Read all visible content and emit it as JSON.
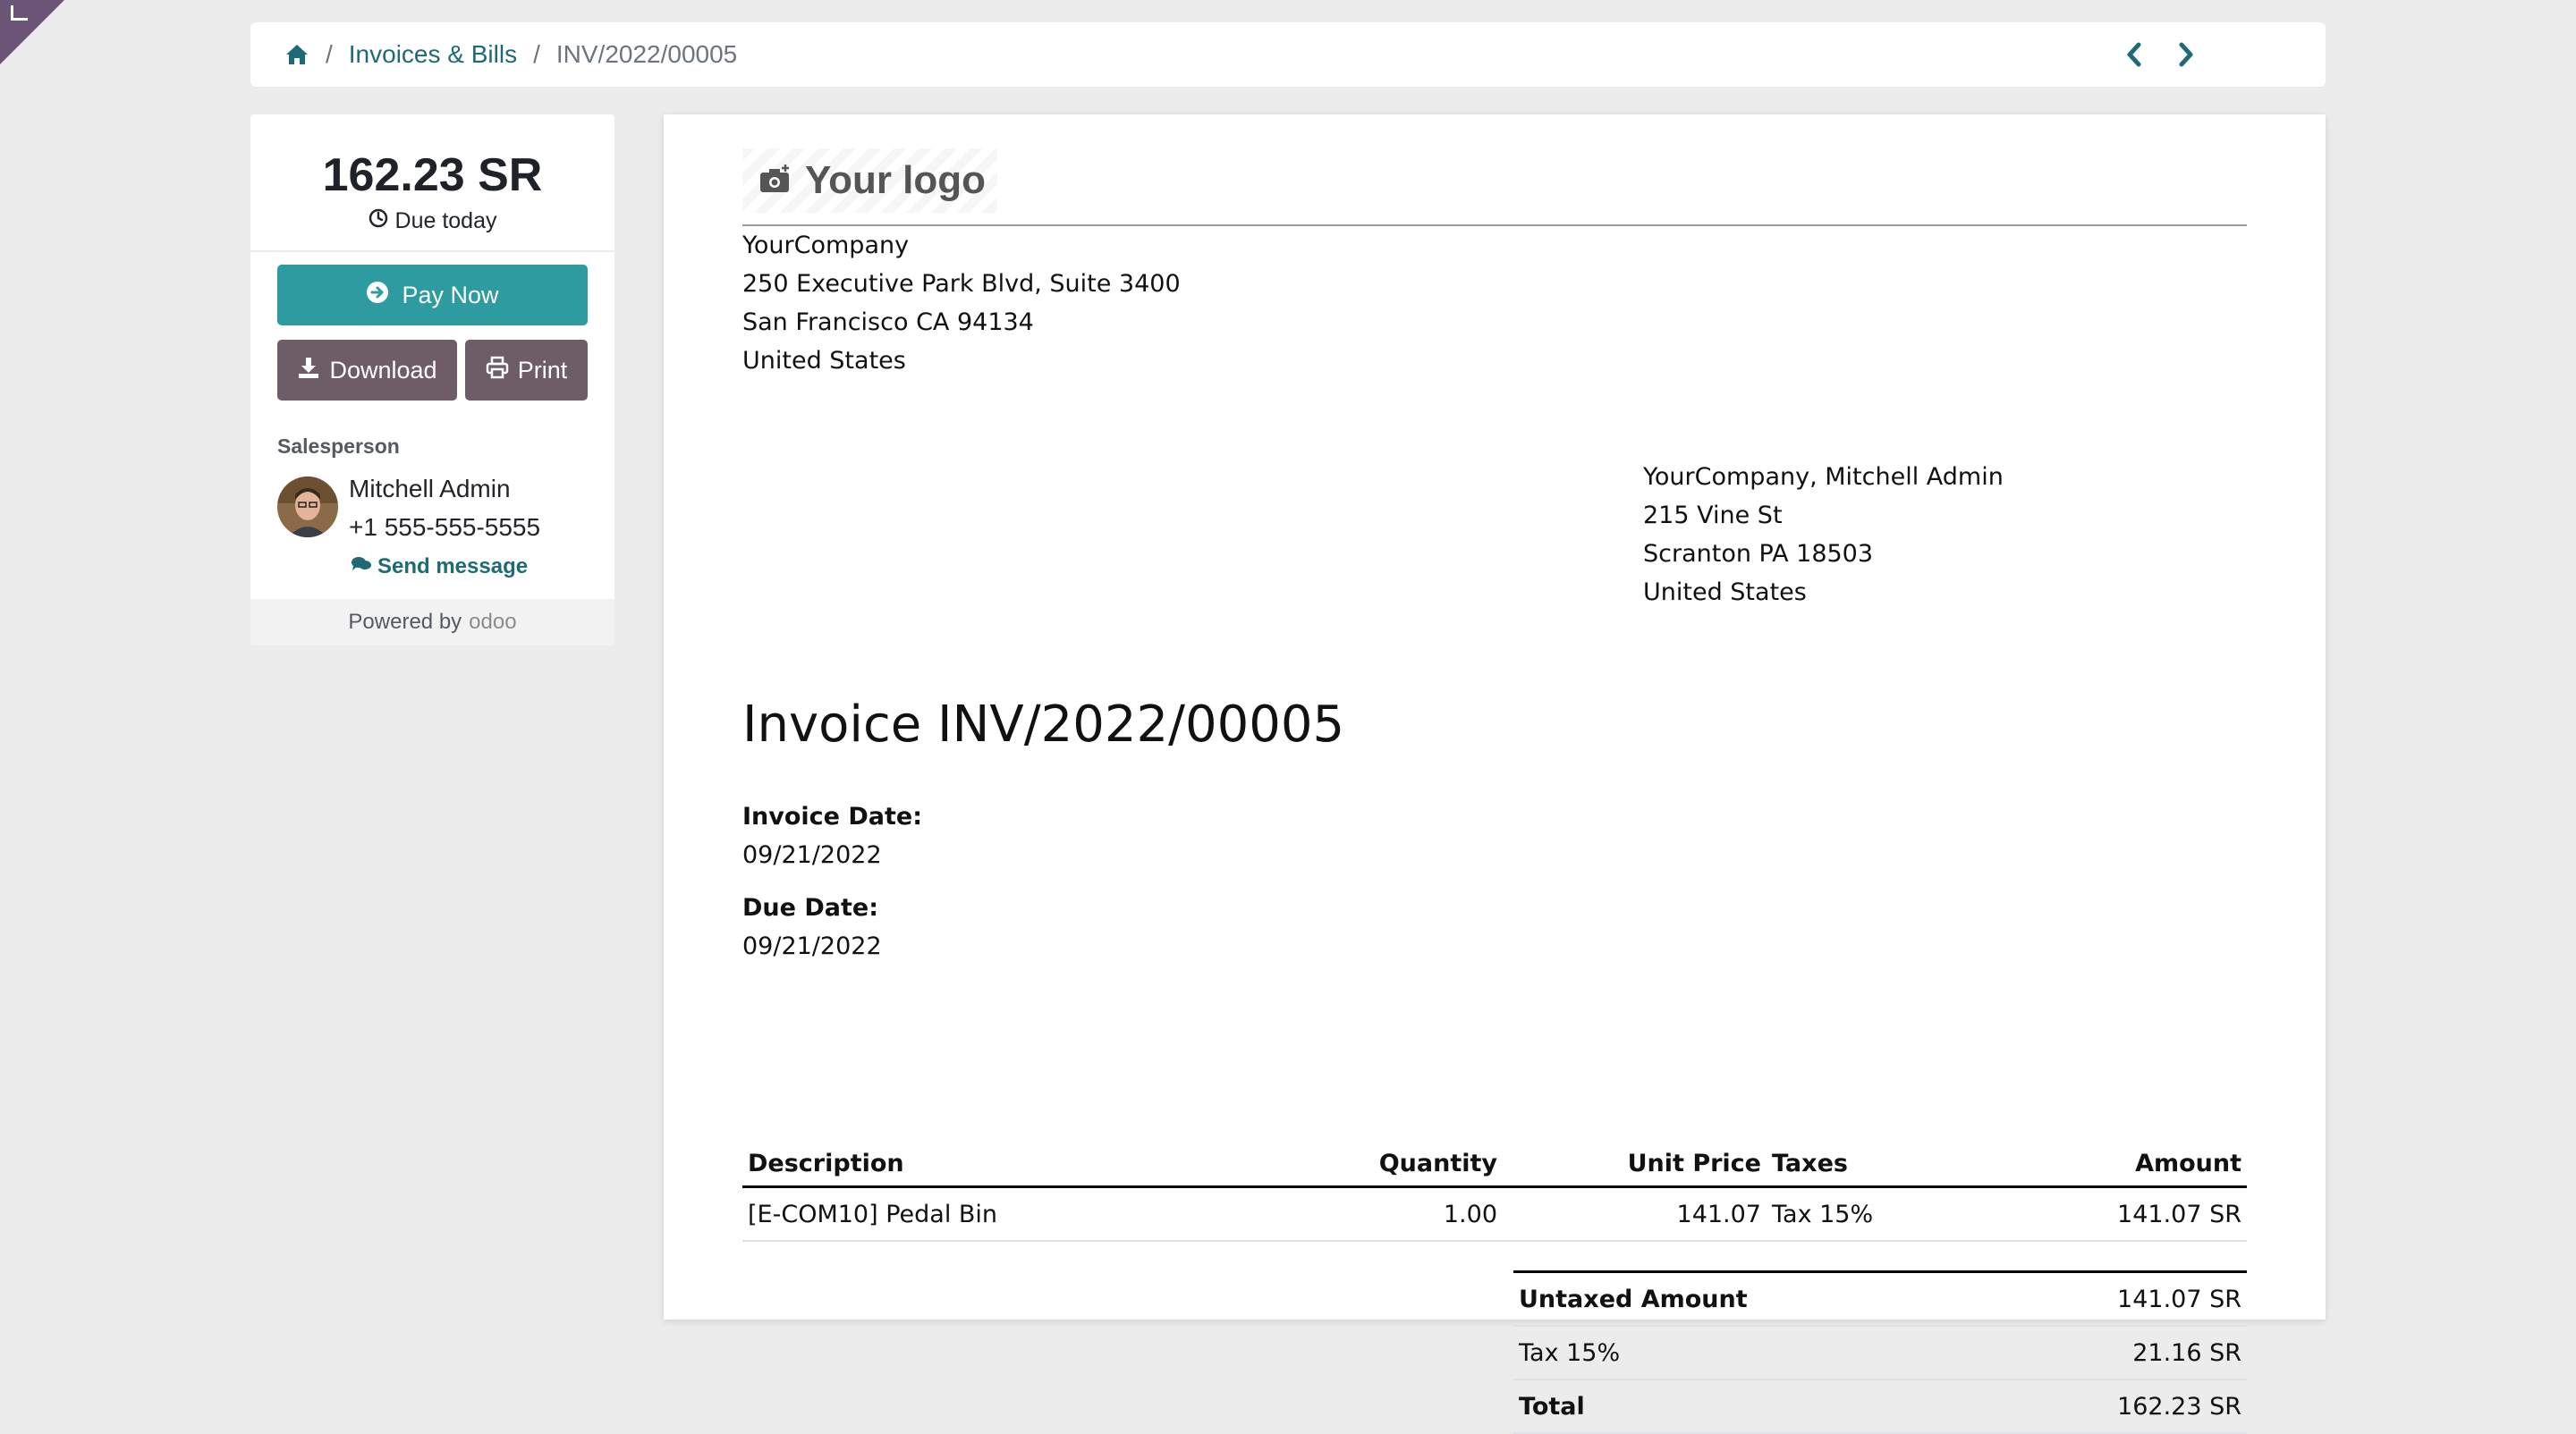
{
  "breadcrumb": {
    "home_icon": "home-icon",
    "section": "Invoices & Bills",
    "current": "INV/2022/00005",
    "separator": "/"
  },
  "pager": {
    "prev_icon": "chevron-left-icon",
    "next_icon": "chevron-right-icon"
  },
  "sidebar": {
    "amount": "162.23 SR",
    "due_text": "Due today",
    "pay_label": "Pay Now",
    "download_label": "Download",
    "print_label": "Print",
    "salesperson_label": "Salesperson",
    "salesperson_name": "Mitchell Admin",
    "salesperson_phone": "+1 555-555-5555",
    "send_message_label": "Send message",
    "powered_by": "Powered by",
    "powered_brand": "odoo"
  },
  "invoice": {
    "logo_text": "Your logo",
    "company_address": [
      "YourCompany",
      "250 Executive Park Blvd, Suite 3400",
      "San Francisco CA 94134",
      "United States"
    ],
    "partner_address": [
      "YourCompany, Mitchell Admin",
      "215 Vine St",
      "Scranton PA 18503",
      "United States"
    ],
    "title": "Invoice INV/2022/00005",
    "invoice_date_label": "Invoice Date:",
    "invoice_date": "09/21/2022",
    "due_date_label": "Due Date:",
    "due_date": "09/21/2022",
    "columns": {
      "description": "Description",
      "quantity": "Quantity",
      "unit_price": "Unit Price",
      "taxes": "Taxes",
      "amount": "Amount"
    },
    "lines": [
      {
        "description": "[E-COM10] Pedal Bin",
        "quantity": "1.00",
        "unit_price": "141.07",
        "taxes": "Tax 15%",
        "amount": "141.07 SR"
      }
    ],
    "totals": [
      {
        "label": "Untaxed Amount",
        "value": "141.07 SR"
      },
      {
        "label": "Tax 15%",
        "value": "21.16 SR"
      },
      {
        "label": "Total",
        "value": "162.23 SR"
      }
    ]
  },
  "colors": {
    "link": "#1f6b75",
    "pay_button": "#2d9ba0",
    "secondary_button": "#6e5c66",
    "corner_tab": "#6b5475"
  }
}
